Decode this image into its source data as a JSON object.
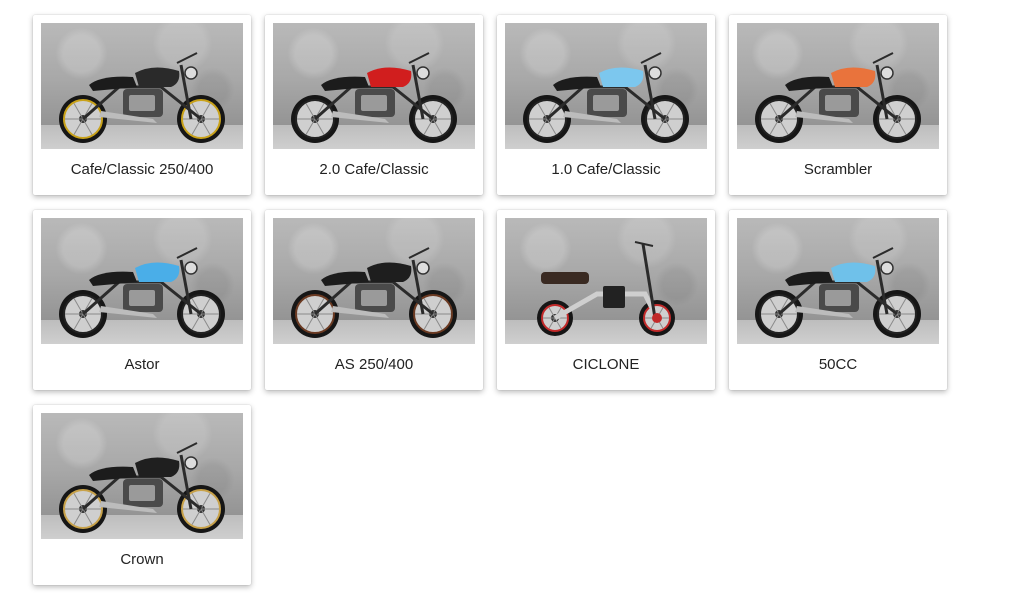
{
  "products": [
    {
      "name": "Cafe/Classic 250/400",
      "tank_color": "#2a2a2a",
      "accent_color": "#c9a21a",
      "icon": "motorcycle-icon"
    },
    {
      "name": "2.0 Cafe/Classic",
      "tank_color": "#d11e1e",
      "accent_color": "#222222",
      "icon": "motorcycle-icon"
    },
    {
      "name": "1.0 Cafe/Classic",
      "tank_color": "#7cc7ee",
      "accent_color": "#222222",
      "icon": "motorcycle-icon"
    },
    {
      "name": "Scrambler",
      "tank_color": "#e9733c",
      "accent_color": "#222222",
      "icon": "motorcycle-icon"
    },
    {
      "name": "Astor",
      "tank_color": "#4aaee8",
      "accent_color": "#222222",
      "icon": "motorcycle-icon"
    },
    {
      "name": "AS 250/400",
      "tank_color": "#1e1e1e",
      "accent_color": "#6b3a22",
      "icon": "motorcycle-icon"
    },
    {
      "name": "CICLONE",
      "tank_color": "#cfcfcf",
      "accent_color": "#c22a2a",
      "icon": "scooter-icon"
    },
    {
      "name": "50CC",
      "tank_color": "#6fc1ea",
      "accent_color": "#222222",
      "icon": "motorcycle-icon"
    },
    {
      "name": "Crown",
      "tank_color": "#1f1f1f",
      "accent_color": "#c8a24a",
      "icon": "motorcycle-icon"
    }
  ]
}
